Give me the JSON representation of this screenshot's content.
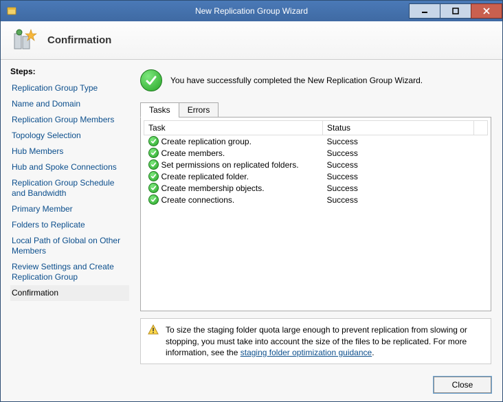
{
  "window": {
    "title": "New Replication Group Wizard"
  },
  "header": {
    "page_title": "Confirmation"
  },
  "steps": {
    "label": "Steps:",
    "items": [
      "Replication Group Type",
      "Name and Domain",
      "Replication Group Members",
      "Topology Selection",
      "Hub Members",
      "Hub and Spoke Connections",
      "Replication Group Schedule and Bandwidth",
      "Primary Member",
      "Folders to Replicate",
      "Local Path of Global on Other Members",
      "Review Settings and Create Replication Group",
      "Confirmation"
    ],
    "current_index": 11
  },
  "success": {
    "message": "You have successfully completed the New Replication Group Wizard."
  },
  "tabs": {
    "items": [
      "Tasks",
      "Errors"
    ],
    "active_index": 0
  },
  "table": {
    "columns": [
      "Task",
      "Status"
    ],
    "rows": [
      {
        "task": "Create replication group.",
        "status": "Success"
      },
      {
        "task": "Create members.",
        "status": "Success"
      },
      {
        "task": "Set permissions on replicated folders.",
        "status": "Success"
      },
      {
        "task": "Create replicated folder.",
        "status": "Success"
      },
      {
        "task": "Create membership objects.",
        "status": "Success"
      },
      {
        "task": "Create connections.",
        "status": "Success"
      }
    ]
  },
  "info": {
    "text_before_link": "To size the staging folder quota large enough to prevent replication from slowing or stopping, you must take into account the size of the files to be replicated. For more information, see the ",
    "link_text": "staging folder optimization guidance",
    "text_after_link": "."
  },
  "footer": {
    "close_label": "Close"
  }
}
